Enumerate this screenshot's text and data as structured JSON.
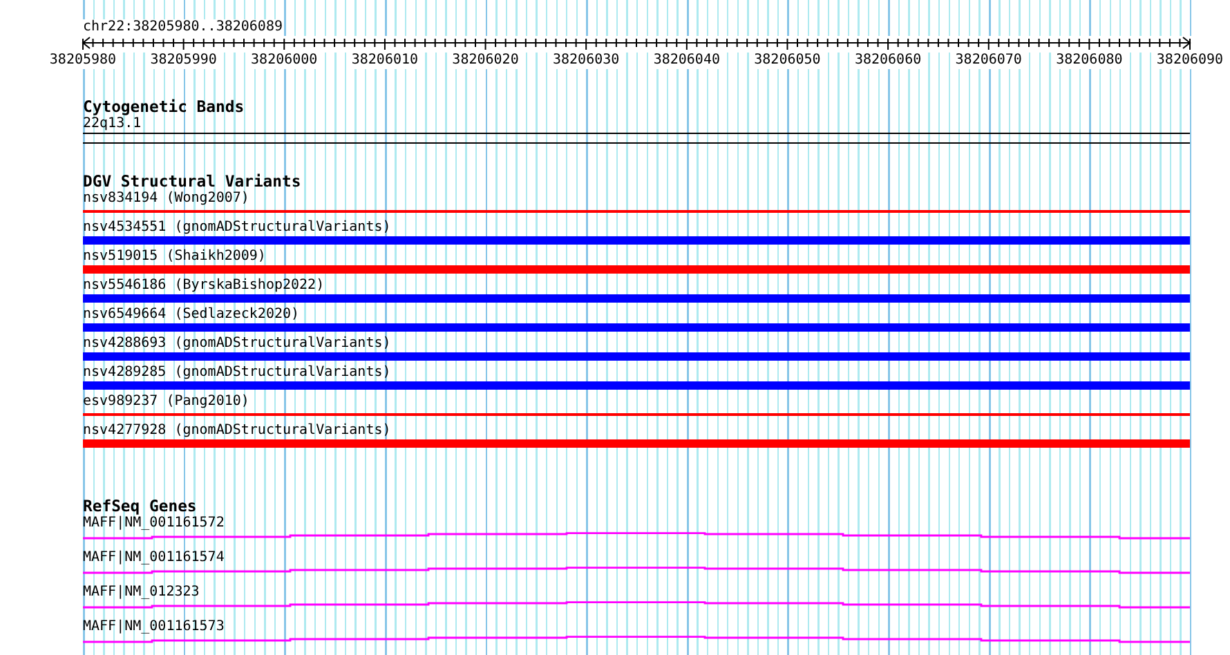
{
  "ruler": {
    "location": "chr22:38205980..38206089",
    "tick_labels": [
      "38205980",
      "38205990",
      "38206000",
      "38206010",
      "38206020",
      "38206030",
      "38206040",
      "38206050",
      "38206060",
      "38206070",
      "38206080",
      "38206090"
    ]
  },
  "tracks": [
    {
      "kind": "cytoband",
      "title": "Cytogenetic Bands",
      "features": [
        {
          "label": "22q13.1"
        }
      ]
    },
    {
      "kind": "variants",
      "title": "DGV Structural Variants",
      "features": [
        {
          "label": "nsv834194 (Wong2007)",
          "kind": "thin",
          "color": "#ff0000"
        },
        {
          "label": "nsv4534551 (gnomADStructuralVariants)",
          "kind": "thick",
          "color": "#0000ff"
        },
        {
          "label": "nsv519015 (Shaikh2009)",
          "kind": "thick",
          "color": "#ff0000"
        },
        {
          "label": "nsv5546186 (ByrskaBishop2022)",
          "kind": "thick",
          "color": "#0000ff"
        },
        {
          "label": "nsv6549664 (Sedlazeck2020)",
          "kind": "thick",
          "color": "#0000ff"
        },
        {
          "label": "nsv4288693 (gnomADStructuralVariants)",
          "kind": "thick",
          "color": "#0000ff"
        },
        {
          "label": "nsv4289285 (gnomADStructuralVariants)",
          "kind": "thick",
          "color": "#0000ff"
        },
        {
          "label": "esv989237 (Pang2010)",
          "kind": "thin",
          "color": "#ff0000"
        },
        {
          "label": "nsv4277928 (gnomADStructuralVariants)",
          "kind": "thick",
          "color": "#ff0000"
        }
      ]
    },
    {
      "kind": "genes",
      "title": "RefSeq Genes",
      "features": [
        {
          "label": "MAFF|NM_001161572"
        },
        {
          "label": "MAFF|NM_001161574"
        },
        {
          "label": "MAFF|NM_012323"
        },
        {
          "label": "MAFF|NM_001161573"
        }
      ]
    }
  ]
}
